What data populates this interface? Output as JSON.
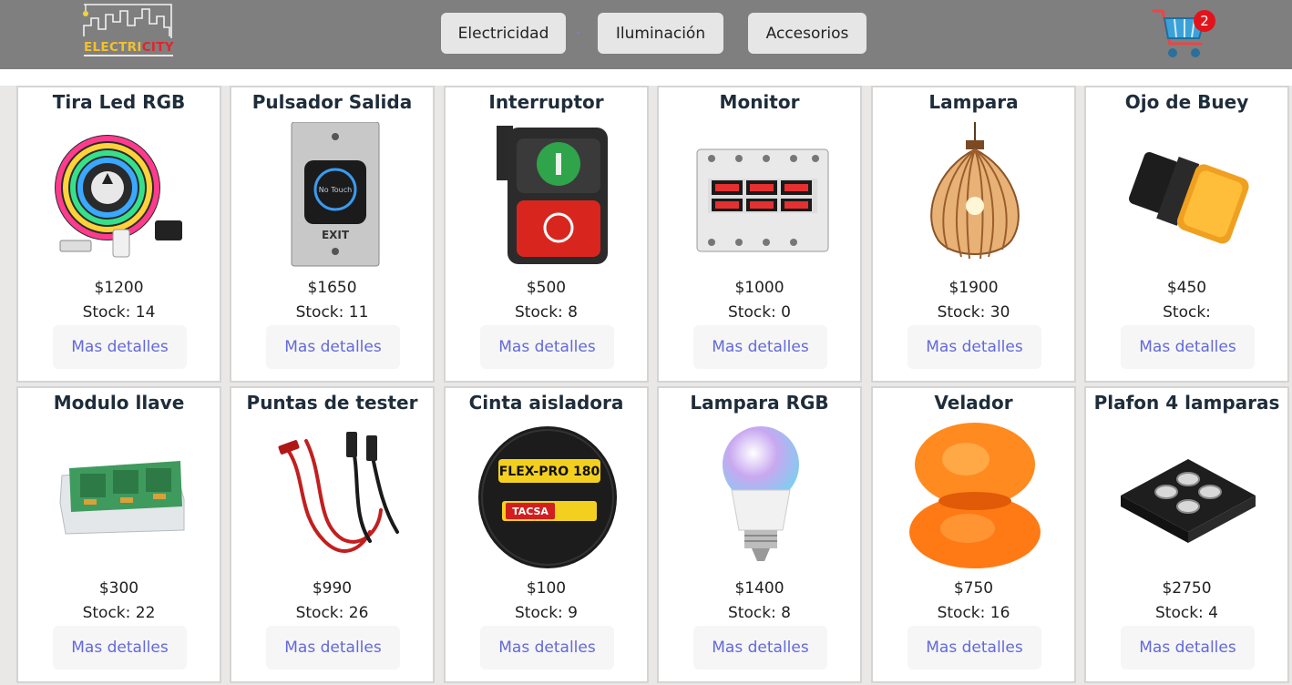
{
  "header": {
    "logo": {
      "part1": "ELECTRI",
      "part2": "CITY"
    },
    "nav": [
      {
        "label": "Electricidad"
      },
      {
        "label": "Iluminación"
      },
      {
        "label": "Accesorios"
      }
    ],
    "nav_separator": "•",
    "cart": {
      "count": "2",
      "icon": "cart-icon"
    }
  },
  "products": [
    {
      "title": "Tira Led RGB",
      "price": "$1200",
      "stock": "Stock: 14",
      "button": "Mas detalles",
      "image": "led-strip-image"
    },
    {
      "title": "Pulsador Salida",
      "price": "$1650",
      "stock": "Stock: 11",
      "button": "Mas detalles",
      "image": "exit-button-image",
      "image_text": {
        "touch": "No Touch",
        "exit": "EXIT"
      }
    },
    {
      "title": "Interruptor",
      "price": "$500",
      "stock": "Stock: 8",
      "button": "Mas detalles",
      "image": "switch-image"
    },
    {
      "title": "Monitor",
      "price": "$1000",
      "stock": "Stock: 0",
      "button": "Mas detalles",
      "image": "voltage-monitor-image"
    },
    {
      "title": "Lampara",
      "price": "$1900",
      "stock": "Stock: 30",
      "button": "Mas detalles",
      "image": "pendant-lamp-image"
    },
    {
      "title": "Ojo de Buey",
      "price": "$450",
      "stock": "Stock:",
      "button": "Mas detalles",
      "image": "indicator-light-image"
    },
    {
      "title": "Modulo llave",
      "price": "$300",
      "stock": "Stock: 22",
      "button": "Mas detalles",
      "image": "switch-module-image"
    },
    {
      "title": "Puntas de tester",
      "price": "$990",
      "stock": "Stock: 26",
      "button": "Mas detalles",
      "image": "test-leads-image"
    },
    {
      "title": "Cinta aisladora",
      "price": "$100",
      "stock": "Stock: 9",
      "button": "Mas detalles",
      "image": "insulating-tape-image",
      "image_text": {
        "brand": "FLEX-PRO 180",
        "maker": "TACSA"
      }
    },
    {
      "title": "Lampara RGB",
      "price": "$1400",
      "stock": "Stock: 8",
      "button": "Mas detalles",
      "image": "rgb-bulb-image"
    },
    {
      "title": "Velador",
      "price": "$750",
      "stock": "Stock: 16",
      "button": "Mas detalles",
      "image": "table-lamp-image"
    },
    {
      "title": "Plafon 4 lamparas",
      "price": "$2750",
      "stock": "Stock: 4",
      "button": "Mas detalles",
      "image": "ceiling-light-image"
    }
  ]
}
